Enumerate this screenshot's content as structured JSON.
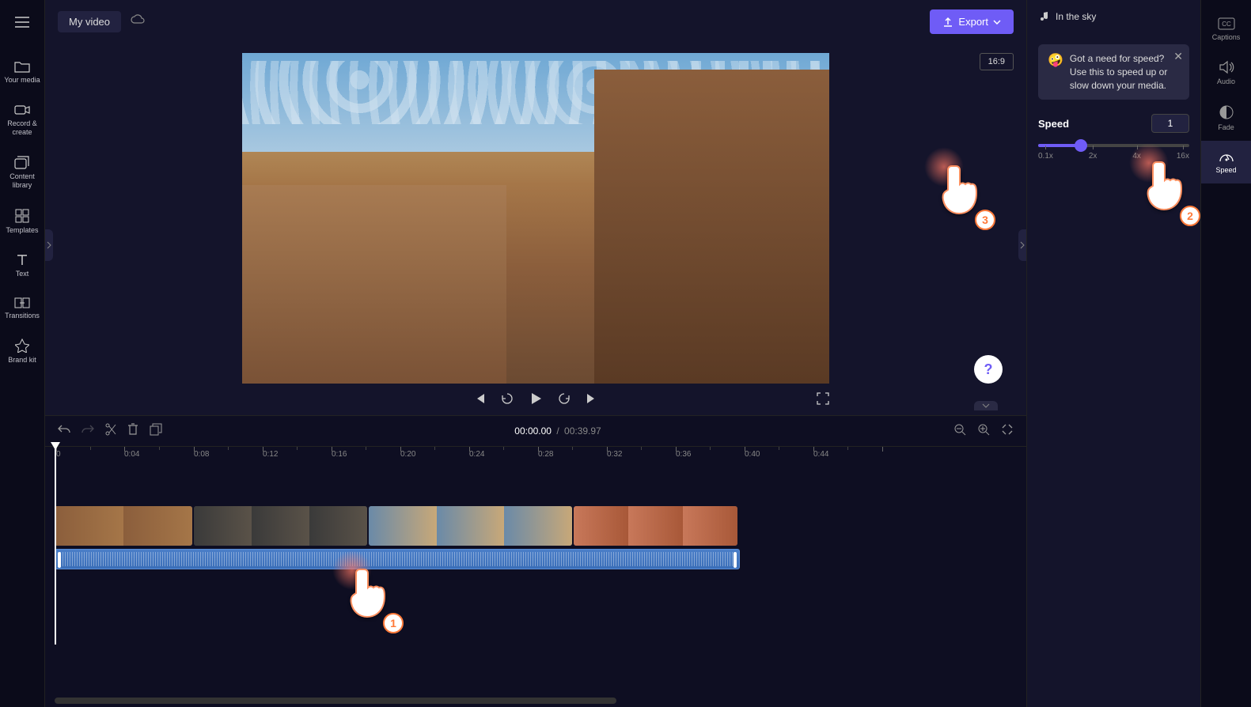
{
  "project": {
    "title": "My video"
  },
  "export": {
    "label": "Export"
  },
  "aspect_ratio": "16:9",
  "sidebar_left": {
    "items": [
      {
        "label": "Your media"
      },
      {
        "label": "Record & create"
      },
      {
        "label": "Content library"
      },
      {
        "label": "Templates"
      },
      {
        "label": "Text"
      },
      {
        "label": "Transitions"
      },
      {
        "label": "Brand kit"
      }
    ]
  },
  "sidebar_right": {
    "items": [
      {
        "label": "Captions"
      },
      {
        "label": "Audio"
      },
      {
        "label": "Fade"
      },
      {
        "label": "Speed"
      }
    ]
  },
  "playback": {
    "current_time": "00:00.00",
    "total_time": "00:39.97"
  },
  "ruler": {
    "marks": [
      "0",
      "0:04",
      "0:08",
      "0:12",
      "0:16",
      "0:20",
      "0:24",
      "0:28",
      "0:32",
      "0:36",
      "0:40",
      "0:44"
    ]
  },
  "audio_clip": {
    "name": "In the sky"
  },
  "speed_panel": {
    "tooltip_emoji": "🤪",
    "tooltip": "Got a need for speed? Use this to speed up or slow down your media.",
    "label": "Speed",
    "value": "1",
    "ticks": [
      "0.1x",
      "2x",
      "4x",
      "16x"
    ]
  },
  "help": {
    "label": "?"
  },
  "callouts": {
    "one": "1",
    "two": "2",
    "three": "3"
  }
}
